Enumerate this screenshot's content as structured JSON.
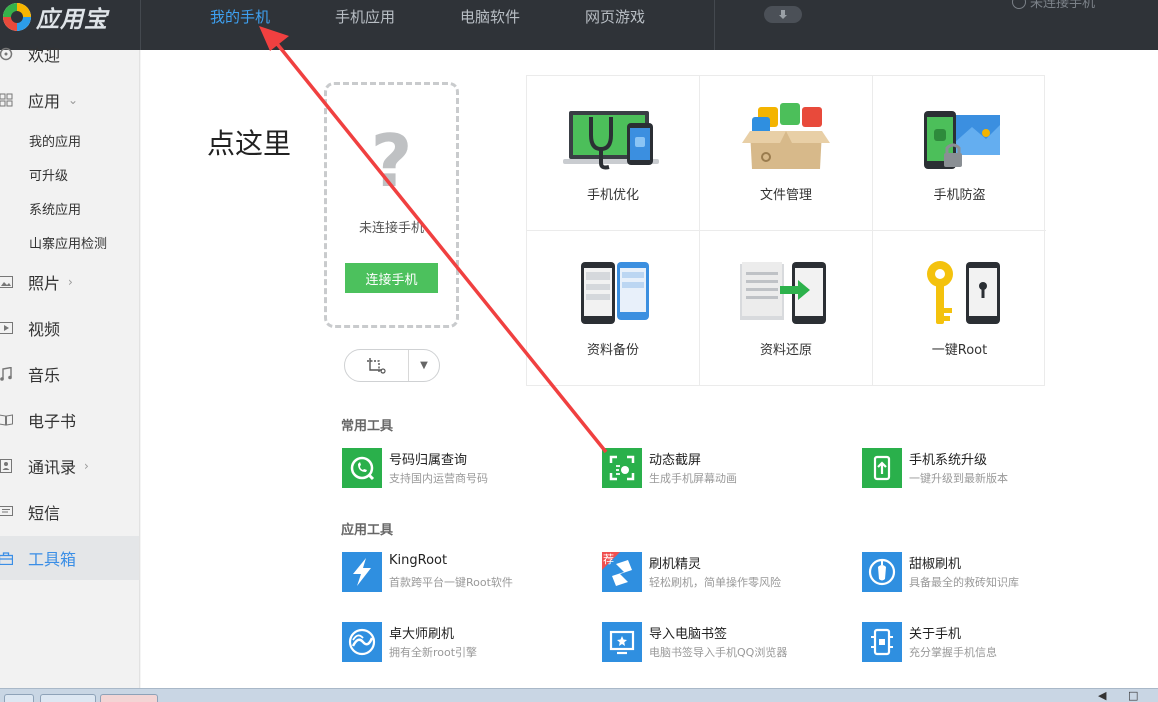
{
  "app": {
    "logo_text": "应用宝"
  },
  "nav": {
    "tabs": [
      {
        "label": "我的手机",
        "active": true
      },
      {
        "label": "手机应用",
        "active": false
      },
      {
        "label": "电脑软件",
        "active": false
      },
      {
        "label": "网页游戏",
        "active": false
      }
    ],
    "connection_status": "未连接手机"
  },
  "sidebar": {
    "welcome": "欢迎",
    "apps": "应用",
    "app_subitems": [
      "我的应用",
      "可升级",
      "系统应用",
      "山寨应用检测"
    ],
    "photos": "照片",
    "video": "视频",
    "music": "音乐",
    "ebook": "电子书",
    "contacts": "通讯录",
    "sms": "短信",
    "toolbox": "工具箱"
  },
  "main": {
    "hint": "点这里",
    "phone_placeholder": "?",
    "not_connected": "未连接手机",
    "connect_button": "连接手机"
  },
  "feature_grid": [
    {
      "label": "手机优化",
      "icon": "phone-optimize-icon"
    },
    {
      "label": "文件管理",
      "icon": "file-manager-icon"
    },
    {
      "label": "手机防盗",
      "icon": "anti-theft-icon"
    },
    {
      "label": "资料备份",
      "icon": "data-backup-icon"
    },
    {
      "label": "资料还原",
      "icon": "data-restore-icon"
    },
    {
      "label": "一键Root",
      "icon": "one-key-root-icon"
    }
  ],
  "common_tools": {
    "title": "常用工具",
    "items": [
      {
        "name": "号码归属查询",
        "desc": "支持国内运营商号码",
        "color": "#2ab04b"
      },
      {
        "name": "动态截屏",
        "desc": "生成手机屏幕动画",
        "color": "#2ab04b"
      },
      {
        "name": "手机系统升级",
        "desc": "一键升级到最新版本",
        "color": "#2ab04b"
      }
    ]
  },
  "app_tools": {
    "title": "应用工具",
    "items": [
      {
        "name": "KingRoot",
        "desc": "首款跨平台一键Root软件",
        "color": "#2f8fe0"
      },
      {
        "name": "刷机精灵",
        "desc": "轻松刷机，简单操作零风险",
        "color": "#2f8fe0",
        "badge": "荐"
      },
      {
        "name": "甜椒刷机",
        "desc": "具备最全的救砖知识库",
        "color": "#2f8fe0"
      },
      {
        "name": "卓大师刷机",
        "desc": "拥有全新root引擎",
        "color": "#2f8fe0"
      },
      {
        "name": "导入电脑书签",
        "desc": "电脑书签导入手机QQ浏览器",
        "color": "#2f8fe0"
      },
      {
        "name": "关于手机",
        "desc": "充分掌握手机信息",
        "color": "#2f8fe0"
      }
    ]
  },
  "colors": {
    "accent": "#3ea1f2",
    "topbar": "#2f3338",
    "green": "#4cc15d",
    "annotation_arrow": "#f04040"
  }
}
